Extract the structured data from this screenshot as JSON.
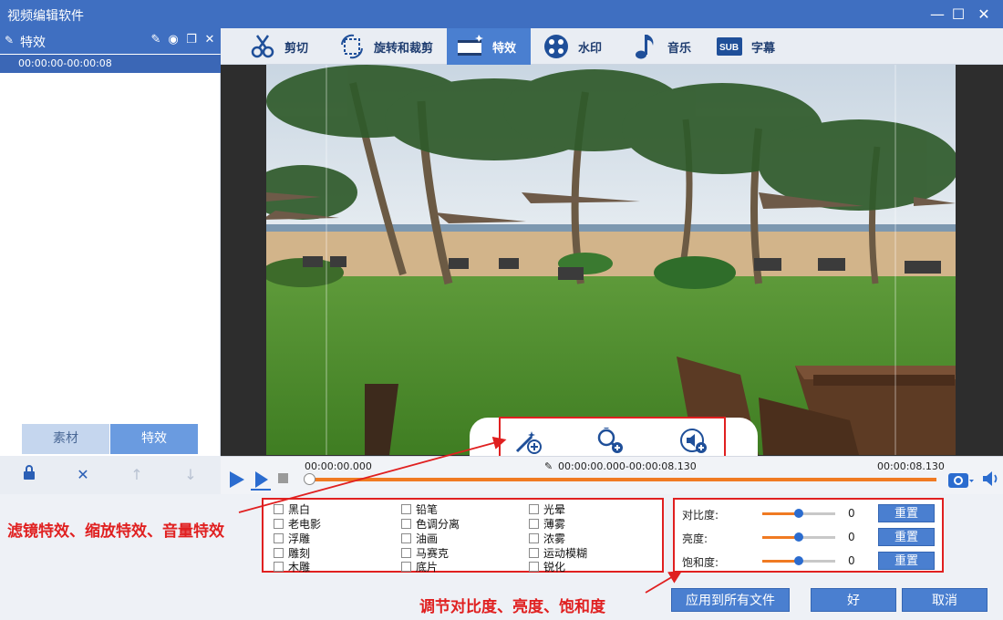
{
  "window": {
    "title": "视频编辑软件",
    "minimize": "—",
    "maximize": "☐",
    "close": "✕"
  },
  "left_panel": {
    "header_label": "特效",
    "clip_range": "00:00:00-00:00:08",
    "tabs": {
      "material": "素材",
      "effects": "特效"
    }
  },
  "toolbar": {
    "items": [
      {
        "label": "剪切",
        "icon": "scissors-icon"
      },
      {
        "label": "旋转和裁剪",
        "icon": "rotate-crop-icon"
      },
      {
        "label": "特效",
        "icon": "film-effect-icon"
      },
      {
        "label": "水印",
        "icon": "watermark-icon"
      },
      {
        "label": "音乐",
        "icon": "music-note-icon"
      },
      {
        "label": "字幕",
        "icon": "subtitle-icon"
      }
    ],
    "active": "特效",
    "subtitle_icon_text": "SUB"
  },
  "timeline": {
    "start": "00:00:00.000",
    "range": "00:00:00.000-00:00:08.130",
    "end": "00:00:08.130",
    "progress": 0.0
  },
  "filters": {
    "col1": [
      "黑白",
      "老电影",
      "浮雕",
      "雕刻",
      "木雕"
    ],
    "col2": [
      "铅笔",
      "色调分离",
      "油画",
      "马赛克",
      "底片"
    ],
    "col3": [
      "光晕",
      "薄雾",
      "浓雾",
      "运动模糊",
      "锐化"
    ]
  },
  "adjust": {
    "rows": [
      {
        "label": "对比度:",
        "value": "0",
        "reset": "重置",
        "level": 0.5
      },
      {
        "label": "亮度:",
        "value": "0",
        "reset": "重置",
        "level": 0.5
      },
      {
        "label": "饱和度:",
        "value": "0",
        "reset": "重置",
        "level": 0.5
      }
    ]
  },
  "buttons": {
    "apply_all": "应用到所有文件",
    "ok": "好",
    "cancel": "取消"
  },
  "annotations": {
    "filters_note": "滤镜特效、缩放特效、音量特效",
    "adjust_note": "调节对比度、亮度、饱和度"
  },
  "colors": {
    "accent": "#3f6fc1",
    "highlight": "#e02020",
    "progress": "#f07a22"
  }
}
